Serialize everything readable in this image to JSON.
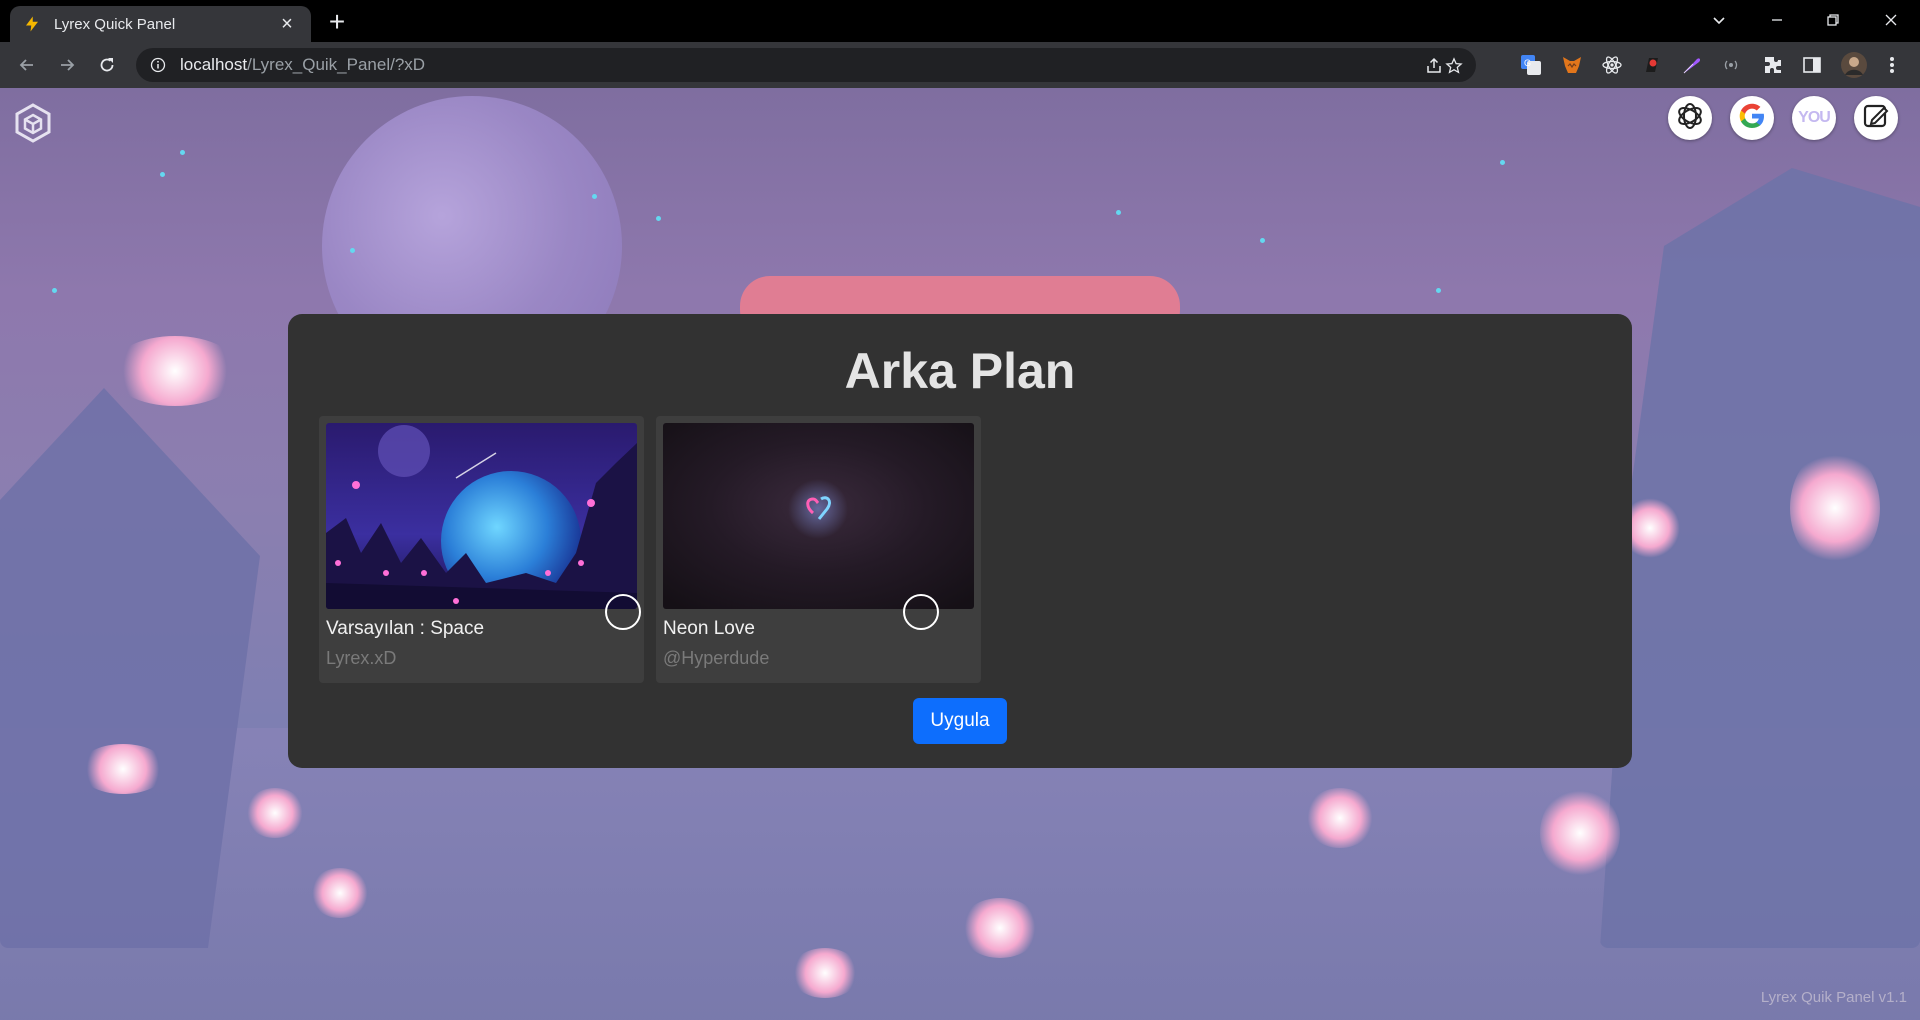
{
  "browser": {
    "tab_title": "Lyrex Quick Panel",
    "url_host": "localhost",
    "url_path": "/Lyrex_Quik_Panel/?xD",
    "icons": [
      "back-icon",
      "forward-icon",
      "reload-icon",
      "info-icon",
      "share-icon",
      "star-icon",
      "extensions-icon",
      "sidepanel-icon",
      "profile-avatar",
      "more-icon"
    ],
    "extensions": [
      "google-translate-icon",
      "metamask-fox-icon",
      "react-devtools-icon",
      "red-extension-icon",
      "purple-feather-icon",
      "radio-icon"
    ]
  },
  "page": {
    "logo": "cube-icon",
    "quick_links": [
      {
        "name": "chatgpt-link",
        "icon": "openai-icon"
      },
      {
        "name": "google-link",
        "icon": "google-icon"
      },
      {
        "name": "you-link",
        "icon": "you-icon",
        "label": "YOU"
      },
      {
        "name": "notes-link",
        "icon": "edit-icon"
      }
    ],
    "panel": {
      "title": "Arka Plan",
      "cards": [
        {
          "name": "Varsayılan : Space",
          "author": "Lyrex.xD"
        },
        {
          "name": "Neon Love",
          "author": "@Hyperdude"
        }
      ],
      "apply_label": "Uygula"
    },
    "version": "Lyrex Quik Panel v1.1"
  },
  "colors": {
    "panel_bg": "#323232",
    "card_bg": "#3e3e3e",
    "apply_button": "#0d6efd",
    "browser_toolbar": "#35363a"
  }
}
